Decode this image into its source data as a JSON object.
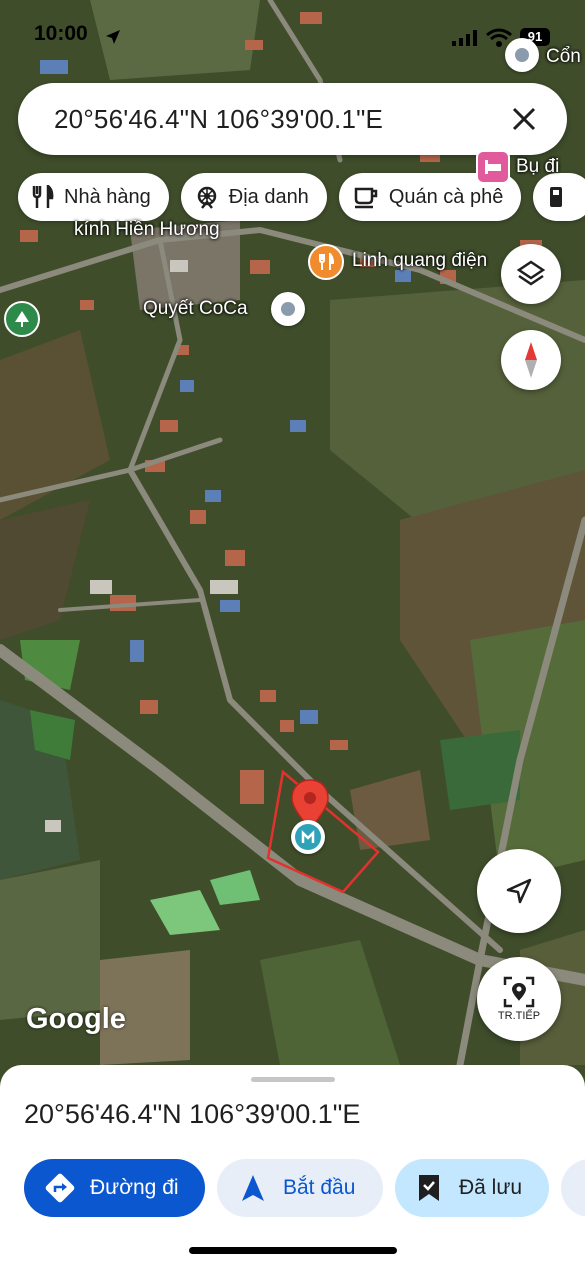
{
  "status_bar": {
    "time": "10:00",
    "battery": "91"
  },
  "search": {
    "query": "20°56'46.4\"N 106°39'00.1\"E"
  },
  "chips": [
    {
      "label": "Nhà hàng",
      "icon": "fork-knife-icon"
    },
    {
      "label": "Địa danh",
      "icon": "landmark-icon"
    },
    {
      "label": "Quán cà phê",
      "icon": "coffee-icon"
    }
  ],
  "map_labels": {
    "top_right": "Cổn",
    "hotel": "Bụ đi",
    "shop": "kính Hiền Hương",
    "restaurant": "Linh quang điện",
    "poi": "Quyết CoCa"
  },
  "colors": {
    "accent": "#0b57d0",
    "pin": "#e94235",
    "boundary": "#e0332d",
    "saved_bg": "#c2e7ff",
    "light_bg": "#e8eef8"
  },
  "map_controls": {
    "street_view_label": "TR.TIẾP"
  },
  "attribution": "Google",
  "place_sheet": {
    "title": "20°56'46.4\"N 106°39'00.1\"E",
    "directions": "Đường đi",
    "start": "Bắt đầu",
    "saved": "Đã lưu"
  }
}
